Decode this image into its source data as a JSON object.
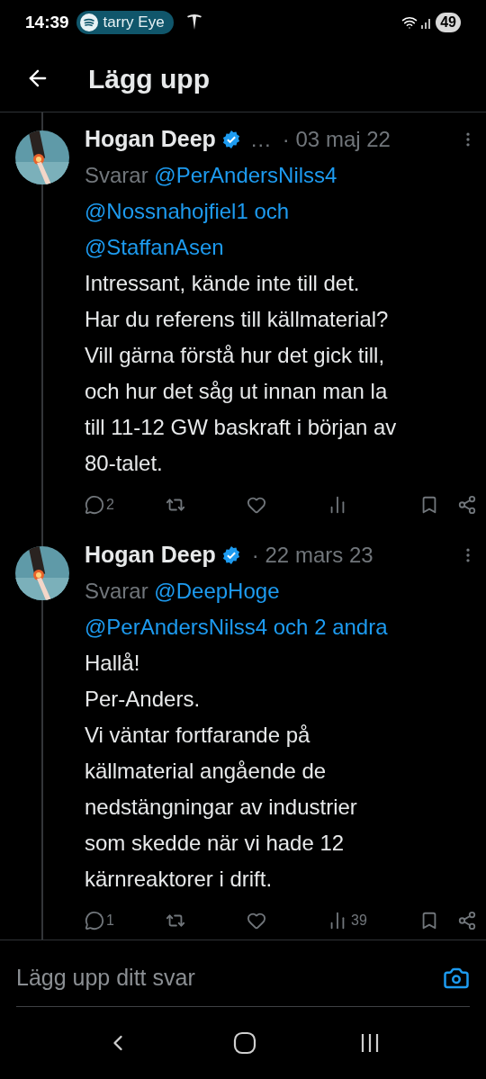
{
  "status_bar": {
    "time": "14:39",
    "media": "tarry Eye",
    "battery": "49"
  },
  "header": {
    "title": "Lägg upp"
  },
  "posts": [
    {
      "name": "Hogan Deep",
      "verified": true,
      "name_truncation": "…",
      "date": "· 03 maj 22",
      "reply_prefix": "Svarar",
      "reply_to": "@PerAndersNilss4\n@Nossnahojfiel1 och\n@StaffanAsen",
      "body": "Intressant, kände inte till det.\nHar du referens till källmaterial?\nVill gärna förstå hur det gick till,\noch hur det såg ut innan man la\ntill 11-12 GW baskraft i början av\n80-talet.",
      "replies": "2"
    },
    {
      "name": "Hogan Deep",
      "verified": true,
      "date": "· 22 mars 23",
      "reply_prefix": "Svarar",
      "reply_to": "@DeepHoge\n@PerAndersNilss4 och 2 andra",
      "body": "Hallå!\nPer-Anders.\nVi väntar fortfarande på\nkällmaterial angående de\nnedstängningar av industrier\nsom skedde när vi hade 12\nkärnreaktorer i drift.",
      "replies": "1",
      "views": "39"
    }
  ],
  "compose": {
    "placeholder": "Lägg upp ditt svar"
  }
}
